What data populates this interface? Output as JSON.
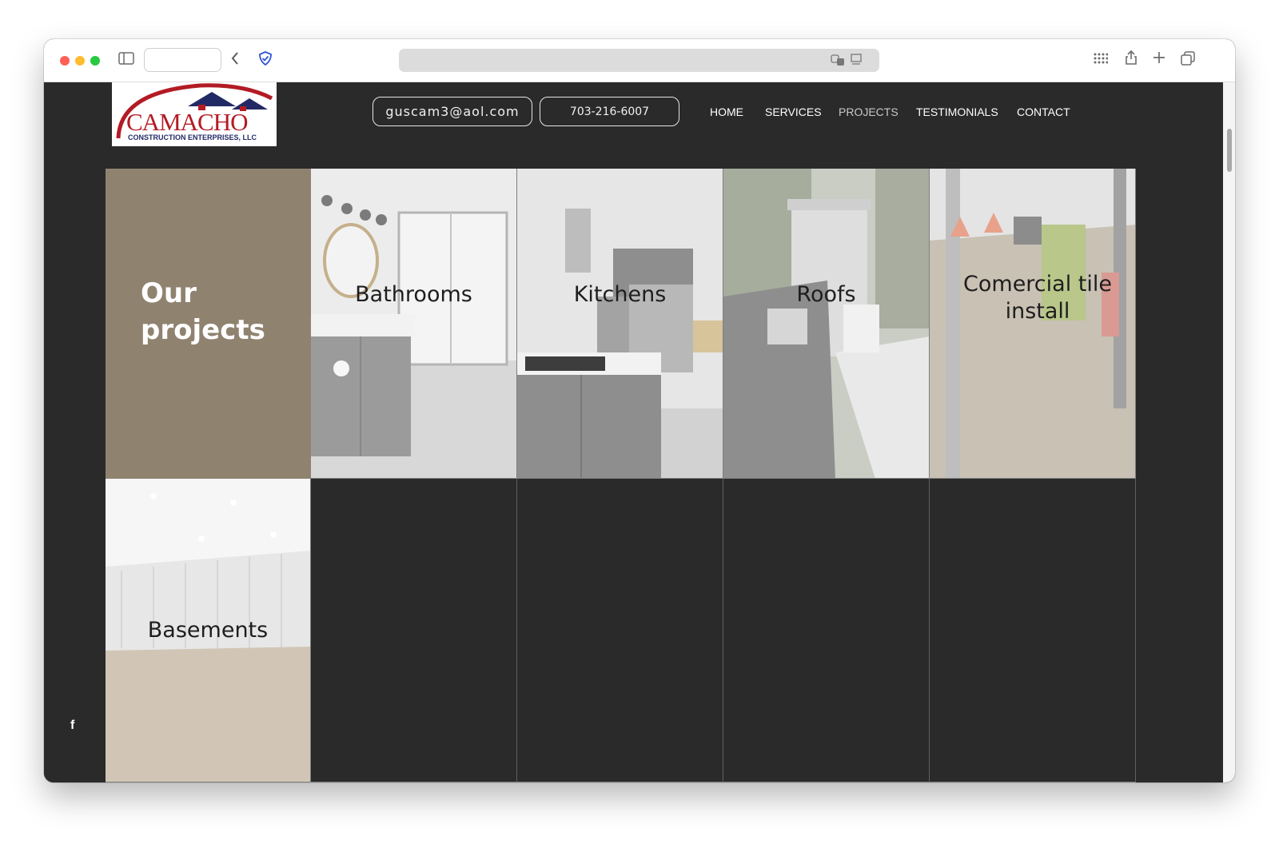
{
  "browser": {
    "icons": [
      "sidebar-icon",
      "back-icon",
      "shield-icon",
      "translate-icon",
      "reader-icon",
      "grid-icon",
      "share-icon",
      "plus-icon",
      "tabs-icon"
    ]
  },
  "header": {
    "logo": {
      "word": "CAMACHO",
      "subtitle": "CONSTRUCTION ENTERPRISES, LLC"
    },
    "email": "guscam3@aol.com",
    "phone": "703-216-6007",
    "nav": [
      "HOME",
      "SERVICES",
      "PROJECTS",
      "TESTIMONIALS",
      "CONTACT"
    ],
    "active_nav": "PROJECTS"
  },
  "projects": {
    "title": "Our projects",
    "items": [
      {
        "label": "Bathrooms"
      },
      {
        "label": "Kitchens"
      },
      {
        "label": "Roofs"
      },
      {
        "label": "Comercial tile install"
      },
      {
        "label": "Basements"
      }
    ]
  },
  "social": {
    "facebook": "f"
  },
  "colors": {
    "background": "#2a2a2a",
    "intro_panel": "#8f8370",
    "logo_red": "#b31b24",
    "logo_navy": "#222a66"
  }
}
